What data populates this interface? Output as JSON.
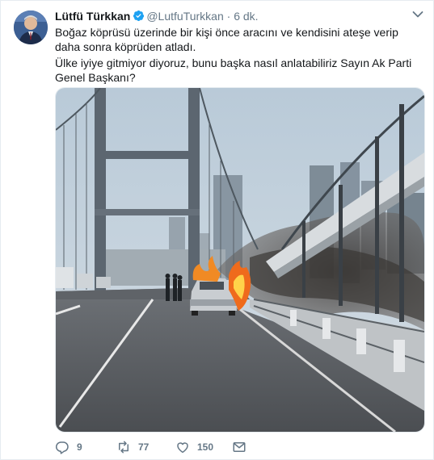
{
  "author": {
    "name": "Lütfü Türkkan",
    "handle": "@LutfuTurkkan",
    "separator": "·",
    "time": "6 dk."
  },
  "tweet": {
    "paragraph_1": "Boğaz köprüsü üzerinde bir kişi önce aracını ve kendisini ateşe verip daha sonra köprüden atladı.",
    "paragraph_2": "Ülke iyiye gitmiyor diyoruz, bunu başka nasıl anlatabiliriz Sayın Ak Parti Genel Başkanı?"
  },
  "actions": {
    "replies": "9",
    "retweets": "77",
    "likes": "150"
  },
  "icons": {
    "verified": "verified-badge-icon",
    "caret": "chevron-down-icon",
    "reply": "reply-icon",
    "retweet": "retweet-icon",
    "like": "heart-icon",
    "dm": "envelope-icon"
  },
  "colors": {
    "verified": "#1da1f2",
    "muted": "#657786",
    "text": "#14171a",
    "border": "#e6ecf0"
  }
}
